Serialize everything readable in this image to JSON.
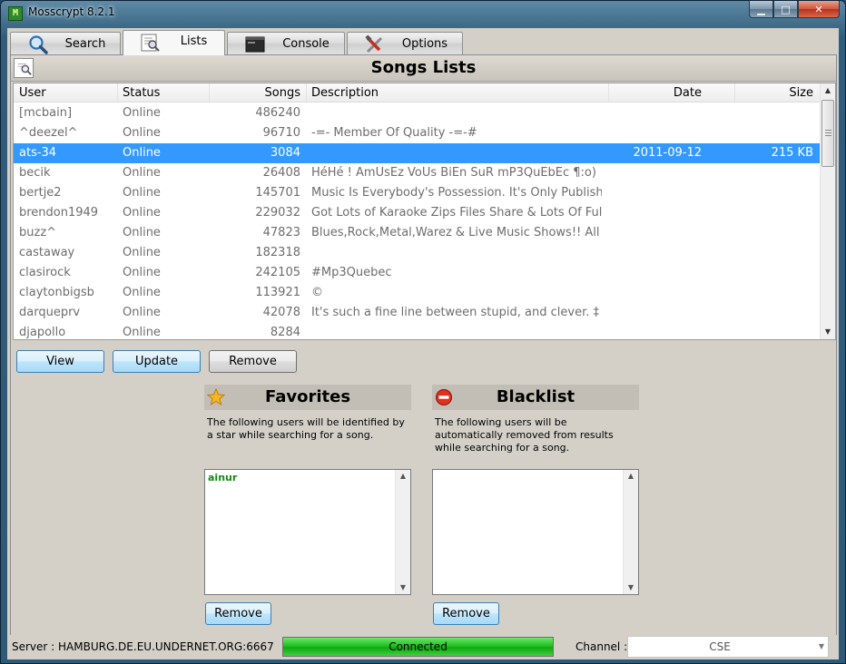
{
  "window": {
    "title": "Mosscrypt 8.2.1",
    "app_icon_text": "M",
    "minimize": "▁",
    "maximize": "□",
    "close": "✕"
  },
  "tabs": [
    {
      "label": "Search",
      "icon": "magnifier-icon"
    },
    {
      "label": "Lists",
      "icon": "list-search-icon",
      "active": true
    },
    {
      "label": "Console",
      "icon": "console-icon"
    },
    {
      "label": "Options",
      "icon": "tools-icon"
    }
  ],
  "songs_lists": {
    "title": "Songs Lists",
    "columns": {
      "user": "User",
      "status": "Status",
      "songs": "Songs",
      "description": "Description",
      "date": "Date",
      "size": "Size"
    },
    "rows": [
      {
        "user": "[mcbain]",
        "status": "Online",
        "songs": "486240",
        "description": "",
        "date": "",
        "size": ""
      },
      {
        "user": "^deezel^",
        "status": "Online",
        "songs": "96710",
        "description": "-=- Member Of Quality -=-#",
        "date": "",
        "size": ""
      },
      {
        "user": "ats-34",
        "status": "Online",
        "songs": "3084",
        "description": "",
        "date": "2011-09-12",
        "size": "215 KB",
        "selected": true
      },
      {
        "user": "becik",
        "status": "Online",
        "songs": "26408",
        "description": "HéHé ! AmUsEz VoUs BiEn SuR mP3QuEbEc ¶:o)",
        "date": "",
        "size": ""
      },
      {
        "user": "bertje2",
        "status": "Online",
        "songs": "145701",
        "description": "Music Is Everybody's Possession. It's Only Publish...",
        "date": "",
        "size": ""
      },
      {
        "user": "brendon1949",
        "status": "Online",
        "songs": "229032",
        "description": "Got Lots of Karaoke Zips Files Share & Lots Of Full ...",
        "date": "",
        "size": ""
      },
      {
        "user": "buzz^",
        "status": "Online",
        "songs": "47823",
        "description": "Blues,Rock,Metal,Warez & Live Music Shows!! All ...",
        "date": "",
        "size": ""
      },
      {
        "user": "castaway",
        "status": "Online",
        "songs": "182318",
        "description": "",
        "date": "",
        "size": ""
      },
      {
        "user": "clasirock",
        "status": "Online",
        "songs": "242105",
        "description": "#Mp3Quebec",
        "date": "",
        "size": ""
      },
      {
        "user": "claytonbigsb",
        "status": "Online",
        "songs": "113921",
        "description": "©",
        "date": "",
        "size": ""
      },
      {
        "user": "darqueprv",
        "status": "Online",
        "songs": "42078",
        "description": "It's such a fine line between stupid, and clever. ‡",
        "date": "",
        "size": ""
      },
      {
        "user": "djapollo",
        "status": "Online",
        "songs": "8284",
        "description": "",
        "date": "",
        "size": ""
      }
    ],
    "buttons": {
      "view": "View",
      "update": "Update",
      "remove": "Remove"
    }
  },
  "favorites": {
    "title": "Favorites",
    "description": "The following users will be identified by a star while searching for a song.",
    "items": [
      "ainur"
    ],
    "remove": "Remove",
    "icon": "star-icon"
  },
  "blacklist": {
    "title": "Blacklist",
    "description": "The following users will be automatically removed from results while searching for a song.",
    "items": [],
    "remove": "Remove",
    "icon": "no-entry-icon"
  },
  "statusbar": {
    "server_label": "Server :",
    "server_value": "HAMBURG.DE.EU.UNDERNET.ORG:6667",
    "connection_status": "Connected",
    "connection_progress": 1.0,
    "channel_label": "Channel :",
    "channel_value": "CSE"
  },
  "colors": {
    "selected_row": "#3399ff",
    "connected": "#22c022",
    "favorite_user": "#138a13"
  }
}
